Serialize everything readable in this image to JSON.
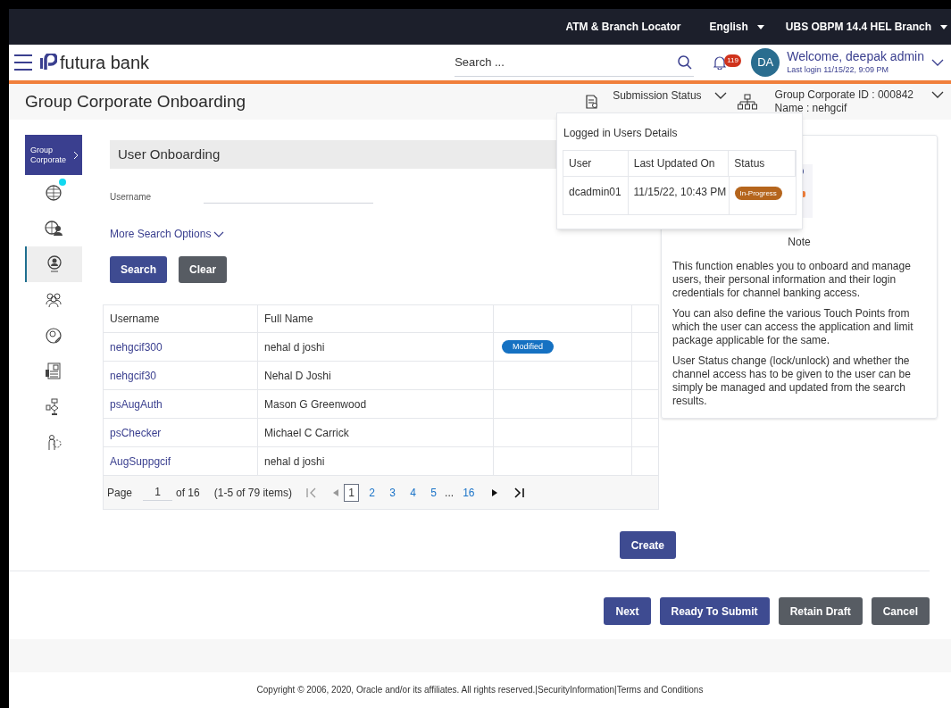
{
  "top_bar": {
    "links": [
      {
        "label": "ATM & Branch Locator",
        "kind": "link"
      },
      {
        "label": "English",
        "kind": "dropdown"
      },
      {
        "label": "UBS OBPM 14.4 HEL Branch",
        "kind": "dropdown"
      }
    ]
  },
  "header": {
    "logo": "futura bank",
    "search": {
      "placeholder": "Search ..."
    },
    "notifications": "119",
    "avatar": "DA",
    "welcome": "Welcome, deepak admin",
    "last_login": "Last login 11/15/22, 9:09 PM"
  },
  "page": {
    "title": "Group Corporate Onboarding",
    "submission_status": "Submission Status",
    "corporate_id": "Group Corporate ID : 000842",
    "corporate_name": "Name : nehgcif"
  },
  "sidebar": [
    {
      "kind": "label",
      "label": "Group Corporate",
      "selected": false
    },
    {
      "kind": "icon",
      "selected": false,
      "dot": true
    },
    {
      "kind": "icon",
      "selected": false
    },
    {
      "kind": "icon",
      "selected": true
    },
    {
      "kind": "icon",
      "selected": false
    },
    {
      "kind": "icon",
      "selected": false
    },
    {
      "kind": "icon",
      "selected": false
    },
    {
      "kind": "icon",
      "selected": false
    },
    {
      "kind": "icon",
      "selected": false
    }
  ],
  "search_section": {
    "title": "User Onboarding",
    "field": {
      "label": "Username"
    },
    "more_options": "More Search Options",
    "buttons": [
      {
        "label": "Search",
        "kind": "primary"
      },
      {
        "label": "Clear",
        "kind": "secondary"
      }
    ]
  },
  "table": {
    "columns": [
      "Username",
      "Full Name"
    ],
    "rows": [
      {
        "username": "nehgcif300",
        "full_name": "nehal d joshi",
        "tag": "Modified"
      },
      {
        "username": "nehgcif30",
        "full_name": "Nehal D Joshi"
      },
      {
        "username": "psAugAuth",
        "full_name": "Mason G Greenwood"
      },
      {
        "username": "psChecker",
        "full_name": "Michael C Carrick"
      },
      {
        "username": "AugSuppgcif",
        "full_name": "nehal d joshi"
      }
    ],
    "pagination": {
      "page_label": "Page",
      "page_value": "1",
      "of_pages": "of 16",
      "items": "(1-5 of 79 items)",
      "pages": [
        {
          "label": "1",
          "kind": "page",
          "selected": true
        },
        {
          "label": "2",
          "kind": "page",
          "selected": false
        },
        {
          "label": "3",
          "kind": "page",
          "selected": false
        },
        {
          "label": "4",
          "kind": "page",
          "selected": false
        },
        {
          "label": "5",
          "kind": "page",
          "selected": false
        },
        {
          "label": "...",
          "kind": "ellipsis"
        },
        {
          "label": "16",
          "kind": "page",
          "selected": false
        }
      ]
    }
  },
  "popup": {
    "title": "Logged in Users Details",
    "columns": [
      "User",
      "Last Updated On",
      "Status"
    ],
    "rows": [
      {
        "user": "dcadmin01",
        "updated": "11/15/22, 10:43 PM",
        "status": "In-Progress"
      }
    ]
  },
  "note": {
    "title": "Note",
    "paragraphs": [
      "This function enables you to onboard and manage users, their personal information and their login credentials for channel banking access.",
      "You can also define the various Touch Points from which the user can access the application and limit package applicable for the same.",
      "User Status change (lock/unlock) and whether the channel access has to be given to the user can be simply be managed and updated from the search results."
    ]
  },
  "create_button": "Create",
  "actions": [
    {
      "label": "Next",
      "kind": "primary"
    },
    {
      "label": "Ready To Submit",
      "kind": "primary"
    },
    {
      "label": "Retain Draft",
      "kind": "secondary"
    },
    {
      "label": "Cancel",
      "kind": "secondary"
    }
  ],
  "footer": "Copyright © 2006, 2020, Oracle and/or its affiliates. All rights reserved.|SecurityInformation|Terms and Conditions"
}
